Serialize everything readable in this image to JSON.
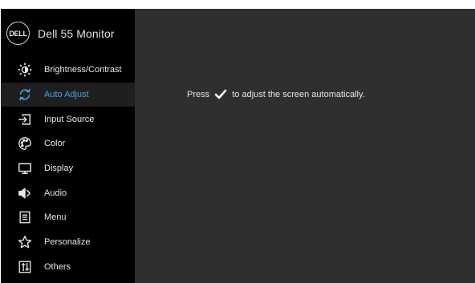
{
  "header": {
    "logo_text": "DELL",
    "title": "Dell 55 Monitor"
  },
  "menu": {
    "active_index": 1,
    "items": [
      {
        "label": "Brightness/Contrast",
        "icon": "brightness-icon"
      },
      {
        "label": "Auto Adjust",
        "icon": "auto-adjust-icon"
      },
      {
        "label": "Input Source",
        "icon": "input-source-icon"
      },
      {
        "label": "Color",
        "icon": "color-palette-icon"
      },
      {
        "label": "Display",
        "icon": "display-icon"
      },
      {
        "label": "Audio",
        "icon": "speaker-icon"
      },
      {
        "label": "Menu",
        "icon": "menu-icon"
      },
      {
        "label": "Personalize",
        "icon": "star-icon"
      },
      {
        "label": "Others",
        "icon": "others-icon"
      }
    ]
  },
  "content": {
    "message_prefix": "Press ",
    "message_suffix": " to adjust the screen automatically.",
    "confirm_icon": "checkmark-icon"
  },
  "colors": {
    "sidebar_bg": "#000000",
    "content_bg": "#2f2f2f",
    "active_row_bg": "#1f1f1f",
    "accent": "#43a6e0",
    "text": "#e6e6e6"
  }
}
